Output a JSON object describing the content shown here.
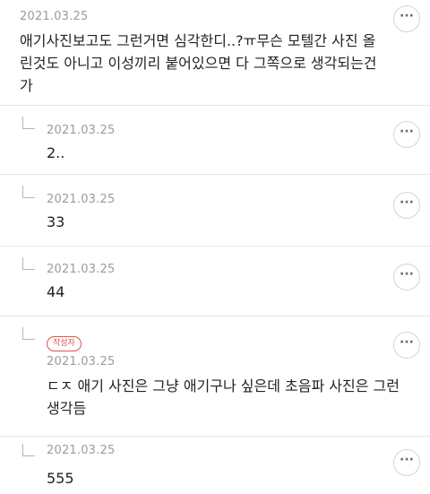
{
  "comments": [
    {
      "date": "2021.03.25",
      "lines": [
        "애기사진보고도 그런거면 심각한디..?ㅠ무슨 모텔간 사진 올",
        "린것도 아니고 이성끼리 붙어있으면 다 그쪽으로 생각되는건",
        "가"
      ],
      "more_label": "···"
    },
    {
      "date": "2021.03.25",
      "text": "2..",
      "more_label": "···"
    },
    {
      "date": "2021.03.25",
      "text": "33",
      "more_label": "···"
    },
    {
      "date": "2021.03.25",
      "text": "44",
      "more_label": "···"
    },
    {
      "badge": "작성자",
      "date": "2021.03.25",
      "lines": [
        "ㄷㅈ 애기 사진은 그냥 애기구나 싶은데 초음파 사진은 그런",
        "생각듬"
      ],
      "more_label": "···"
    },
    {
      "date": "2021.03.25",
      "text": "555",
      "more_label": "···"
    }
  ]
}
